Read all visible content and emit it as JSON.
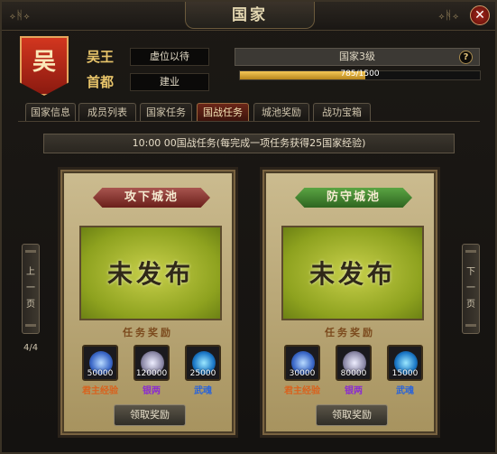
{
  "window": {
    "title": "国家",
    "ornament_left": "⟡ᚻ⟡",
    "ornament_right": "⟡ᚻ⟡",
    "close_label": "✕"
  },
  "header": {
    "banner_char": "吴",
    "king_label": "吴王",
    "king_value": "虚位以待",
    "capital_label": "首都",
    "capital_value": "建业",
    "level_text": "国家3级",
    "help_label": "?",
    "exp_text": "785/1500",
    "exp_fraction": 0.523
  },
  "tabs": [
    {
      "label": "国家信息"
    },
    {
      "label": "成员列表"
    },
    {
      "label": "国家任务"
    },
    {
      "label": "国战任务"
    },
    {
      "label": "城池奖励"
    },
    {
      "label": "战功宝箱"
    }
  ],
  "active_tab": 3,
  "announcement": "10:00 00国战任务(每完成一项任务获得25国家经验)",
  "pager": {
    "prev_label": "上一页",
    "next_label": "下一页",
    "page_text": "4/4"
  },
  "panels": [
    {
      "ribbon": "攻下城池",
      "ribbon_color": "#8b3a33",
      "status": "未发布",
      "reward_title": "任务奖励",
      "rewards": [
        {
          "qty": "50000",
          "name": "君主经验",
          "icon": "exp-orb-icon"
        },
        {
          "qty": "120000",
          "name": "银两",
          "icon": "silver-ingot-icon"
        },
        {
          "qty": "25000",
          "name": "武魂",
          "icon": "soul-orb-icon"
        }
      ],
      "claim_label": "领取奖励"
    },
    {
      "ribbon": "防守城池",
      "ribbon_color": "#3f8a2f",
      "status": "未发布",
      "reward_title": "任务奖励",
      "rewards": [
        {
          "qty": "30000",
          "name": "君主经验",
          "icon": "exp-orb-icon"
        },
        {
          "qty": "80000",
          "name": "银两",
          "icon": "silver-ingot-icon"
        },
        {
          "qty": "15000",
          "name": "武魂",
          "icon": "soul-orb-icon"
        }
      ],
      "claim_label": "领取奖励"
    }
  ]
}
